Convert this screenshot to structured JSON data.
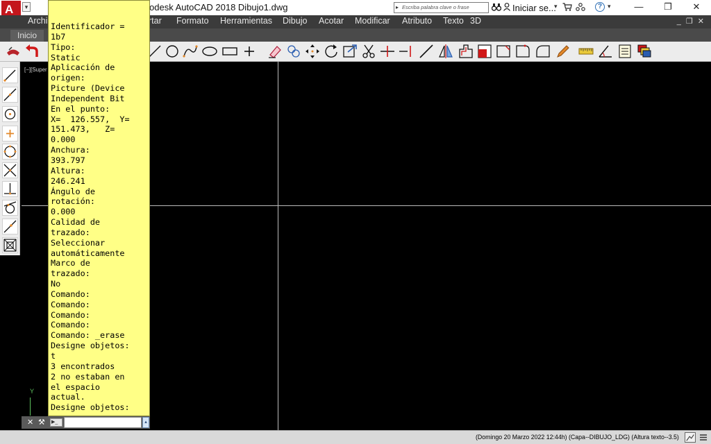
{
  "app": {
    "logo": "A",
    "quick_access_caret": "▾",
    "title": "odesk AutoCAD 2018    Dibujo1.dwg",
    "search_placeholder": "Escriba palabra clave o frase",
    "search_caret": "▸",
    "signin_label": "Iniciar se...",
    "caret": "▾",
    "help_label": "?",
    "window_controls": {
      "minimize": "—",
      "maximize": "❐",
      "close": "✕"
    }
  },
  "menubar": {
    "items": [
      "Archi",
      "rtar",
      "Formato",
      "Herramientas",
      "Dibujo",
      "Acotar",
      "Modificar",
      "Atributo",
      "Texto",
      "3D"
    ],
    "doc_controls": "_ ❐ ✕"
  },
  "tabs": [
    {
      "label": "Inicio",
      "active": true
    }
  ],
  "toolbar": {
    "icons": [
      "drag-icon",
      "undo-icon",
      "line-icon",
      "circle-icon",
      "spline-icon",
      "ellipse-icon",
      "rectangle-icon",
      "point-icon",
      "erase-icon",
      "copy-icon",
      "move-icon",
      "rotate-icon",
      "scale-icon",
      "trim-icon",
      "extend-icon",
      "break-icon",
      "lengthen-icon",
      "mirror-icon",
      "offset-icon",
      "fill-icon",
      "chamfer-icon",
      "fillet-icon",
      "round-icon",
      "pencil-icon",
      "ruler-icon",
      "angle-icon",
      "list-icon",
      "layers-icon"
    ],
    "colors": {
      "accent_red": "#d01818",
      "accent_orange": "#e2882a",
      "accent_blue": "#2a5db0"
    }
  },
  "palette": {
    "icons": [
      "line-tool-icon",
      "construction-line-icon",
      "circle-center-icon",
      "point-snap-icon",
      "circle-quad-icon",
      "intersection-icon",
      "perpendicular-icon",
      "tangent-icon",
      "nearest-icon",
      "osnap-settings-icon"
    ]
  },
  "viewport": {
    "label": "[−][Super",
    "ucs_y": "Y"
  },
  "text_window": {
    "lines": [
      "Identificador =",
      "1b7",
      "Tipo:",
      "Static",
      "Aplicación de",
      "origen:",
      "Picture (Device",
      "Independent Bit",
      "En el punto:",
      "X=  126.557,  Y=",
      "151.473,   Z=",
      "0.000",
      "Anchura:",
      "393.797",
      "Altura:",
      "246.241",
      "Ángulo de",
      "rotación:",
      "0.000",
      "Calidad de",
      "trazado:",
      "Seleccionar",
      "automáticamente",
      "Marco de",
      "trazado:",
      "No",
      "Comando:",
      "Comando:",
      "Comando:",
      "Comando:",
      "Comando: _erase",
      "Designe objetos:",
      "t",
      "3 encontrados",
      "2 no estaban en",
      "el espacio",
      "actual.",
      "Designe objetos:"
    ]
  },
  "command_line": {
    "close_icon": "✕",
    "wrench_icon": "⚒",
    "prompt_icon": "▶_",
    "input_value": "",
    "scroll_icon": "▴"
  },
  "status_bar": {
    "text": "(Domingo 20 Marzo 2022  12:44h)  (Capa--DIBUJO_LDG)  (Altura texto--3.5)"
  }
}
